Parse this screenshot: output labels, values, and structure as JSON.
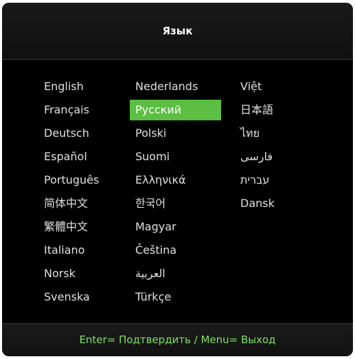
{
  "title": "Язык",
  "columns": [
    [
      "English",
      "Français",
      "Deutsch",
      "Español",
      "Português",
      "简体中文",
      "繁體中文",
      "Italiano",
      "Norsk",
      "Svenska"
    ],
    [
      "Nederlands",
      "Русский",
      "Polski",
      "Suomi",
      "Ελληνικά",
      "한국어",
      "Magyar",
      "Čeština",
      "العربية",
      "Türkçe"
    ],
    [
      "Việt",
      "日本語",
      "ไทย",
      "فارسی",
      "עברית",
      "Dansk"
    ]
  ],
  "selected": "Русский",
  "footer": "Enter= Подтвердить / Menu= Выход",
  "colors": {
    "accent": "#5cbe43",
    "footer_text": "#7ee15f",
    "background": "#000000",
    "text": "#e0e0e0"
  }
}
